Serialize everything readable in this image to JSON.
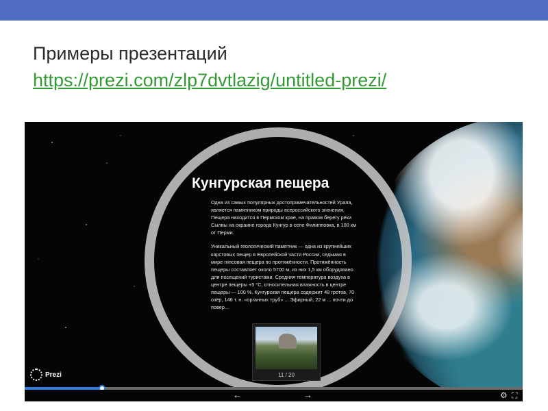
{
  "page": {
    "title": "Примеры презентаций",
    "link": "https://prezi.com/zlp7dvtlazig/untitled-prezi/"
  },
  "viewer": {
    "slide_title": "Кунгурская пещера",
    "slide_paragraphs": [
      "Одна из самых популярных достопримечательностей Урала, является памятником природы всероссийского значения. Пещера находится в Пермском крае, на правом берегу реки Сылвы на окраине города Кунгур в селе Филипповка, в 100 км от Перми.",
      "Уникальный геологический памятник — одна из крупнейших карстовых пещер в Европейской части России, седьмая в мире гипсовая пещера по протяжённости. Протяжённость пещеры составляет около 5700 м, из них 1,5 км оборудовано для посещений туристами. Средняя температура воздуха в центре пещеры +5 °C, относительная влажность в центре пещеры — 100 %. Кунгурская пещера содержит 48 гротов, 70 озёр, 146 т. н. «органных труб» ... Эфирный, 22 м ... почти до повер..."
    ],
    "thumbnail_counter": "11 / 20",
    "logo_text": "Prezi",
    "progress": 0.155,
    "icons": {
      "prev": "arrow-left-icon",
      "next": "arrow-right-icon",
      "settings": "gear-icon",
      "fullscreen": "fullscreen-icon"
    }
  },
  "colors": {
    "topbar": "#4f6cc3",
    "link": "#339933",
    "progress": "#2f7de1"
  }
}
